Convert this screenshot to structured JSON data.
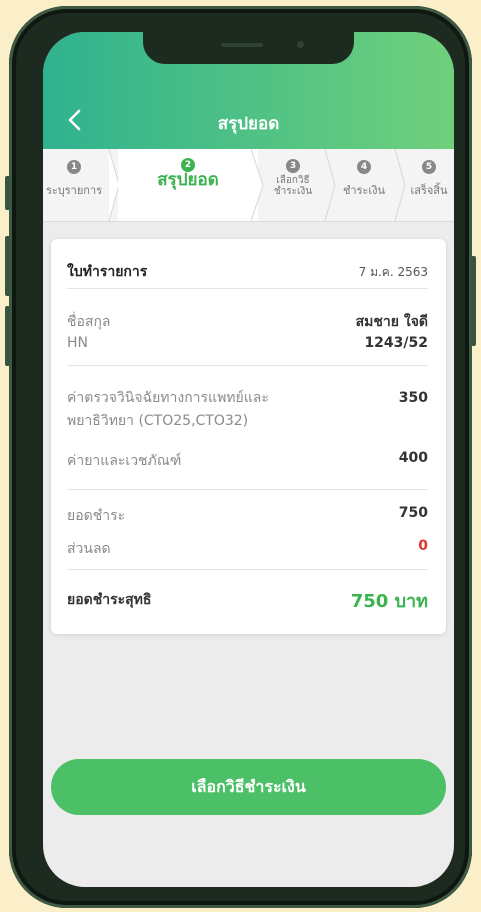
{
  "header": {
    "title": "สรุปยอด",
    "back_icon": "chevron-left-icon"
  },
  "steps": [
    {
      "num": "1",
      "label": "ระบุรายการ"
    },
    {
      "num": "2",
      "label": "สรุปยอด"
    },
    {
      "num": "3",
      "label_line1": "เลือกวิธี",
      "label_line2": "ชำระเงิน"
    },
    {
      "num": "4",
      "label": "ชำระเงิน"
    },
    {
      "num": "5",
      "label": "เสร็จสิ้น"
    }
  ],
  "receipt": {
    "heading": "ใบทำรายการ",
    "date": "7 ม.ค. 2563",
    "name_label": "ชื่อสกุล",
    "name_value": "สมชาย ใจดี",
    "hn_label": "HN",
    "hn_value": "1243/52",
    "item1_label_line1": "ค่าตรวจวินิจฉัยทางการแพทย์และ",
    "item1_label_line2": "พยาธิวิทยา (CTO25,CTO32)",
    "item1_value": "350",
    "item2_label": "ค่ายาและเวชภัณฑ์",
    "item2_value": "400",
    "payable_label": "ยอดชำระ",
    "payable_value": "750",
    "discount_label": "ส่วนลด",
    "discount_value": "0",
    "net_label": "ยอดชำระสุทธิ",
    "net_value": "750 บาท"
  },
  "cta": {
    "label": "เลือกวิธีชำระเงิน"
  },
  "colors": {
    "accent": "#3bb34f",
    "discount": "#e0352b"
  }
}
